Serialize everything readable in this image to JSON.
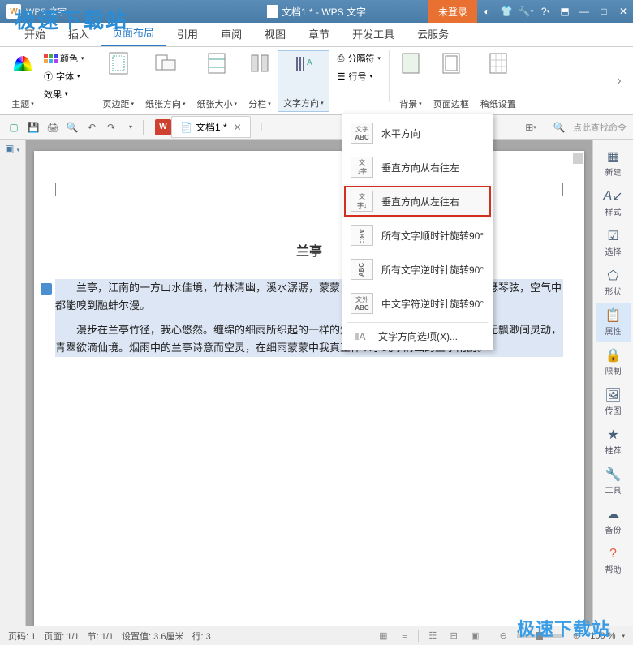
{
  "watermarks": {
    "top_left": "极速下载站",
    "bottom_right": "极速下载站"
  },
  "titlebar": {
    "app_short": "W",
    "doc_title": "文档1 * - WPS 文字",
    "login_button": "未登录"
  },
  "ribbon_tabs": {
    "items": [
      "开始",
      "插入",
      "页面布局",
      "引用",
      "审阅",
      "视图",
      "章节",
      "开发工具",
      "云服务"
    ],
    "active_index": 2
  },
  "ribbon": {
    "theme": "主题",
    "font_marker": "Ⓣ",
    "font": "字体",
    "effect": "效果",
    "colors": "颜色",
    "margins": "页边距",
    "orientation": "纸张方向",
    "size": "纸张大小",
    "columns": "分栏",
    "text_direction": "文字方向",
    "separator": "分隔符",
    "line_number": "行号",
    "background": "背景",
    "page_border": "页面边框",
    "manuscript": "稿纸设置"
  },
  "quickbar": {
    "doc_tab_label": "文档1 *",
    "search_placeholder": "点此查找命令"
  },
  "dropdown": {
    "items": [
      {
        "label": "水平方向"
      },
      {
        "label": "垂直方向从右往左"
      },
      {
        "label": "垂直方向从左往右",
        "highlighted": true
      },
      {
        "label": "所有文字顺时针旋转90°"
      },
      {
        "label": "所有文字逆时针旋转90°"
      },
      {
        "label": "中文字符逆时针旋转90°"
      }
    ],
    "footer": "文字方向选项(X)..."
  },
  "document": {
    "title": "兰亭",
    "p1": "兰亭，江南的一方山水佳境，竹林清幽，溪水潺潺，蒙蒙，如诗如画。风拂过竹林拂动瑟瑟琴弦，空气中都能嗅到融蚌尔漫。",
    "p2": "漫步在兰亭竹径，我心悠然。缠绵的细雨所织起的一样的烟岚，使山水、竹林、花草在虚无飘渺间灵动，青翠欲滴仙境。烟雨中的兰亭诗意而空灵，在细雨蒙蒙中我真正体味了纯净清幽的兰亭雨韵。"
  },
  "right_panel": {
    "items": [
      {
        "icon": "doc",
        "label": "新建"
      },
      {
        "icon": "A",
        "label": "样式"
      },
      {
        "icon": "check",
        "label": "选择"
      },
      {
        "icon": "hex",
        "label": "形状"
      },
      {
        "icon": "doc2",
        "label": "属性",
        "active": true
      },
      {
        "icon": "lock",
        "label": "限制"
      },
      {
        "icon": "stack",
        "label": "传图"
      },
      {
        "icon": "star",
        "label": "推荐"
      },
      {
        "icon": "wrench",
        "label": "工具",
        "coral": true
      },
      {
        "icon": "cloud",
        "label": "备份"
      },
      {
        "icon": "help",
        "label": "帮助",
        "coral": true
      }
    ]
  },
  "statusbar": {
    "page_no": "页码: 1",
    "page_total": "页面: 1/1",
    "section": "节: 1/1",
    "set_value": "设置值: 3.6厘米",
    "row": "行: 3",
    "zoom": "100 %"
  }
}
